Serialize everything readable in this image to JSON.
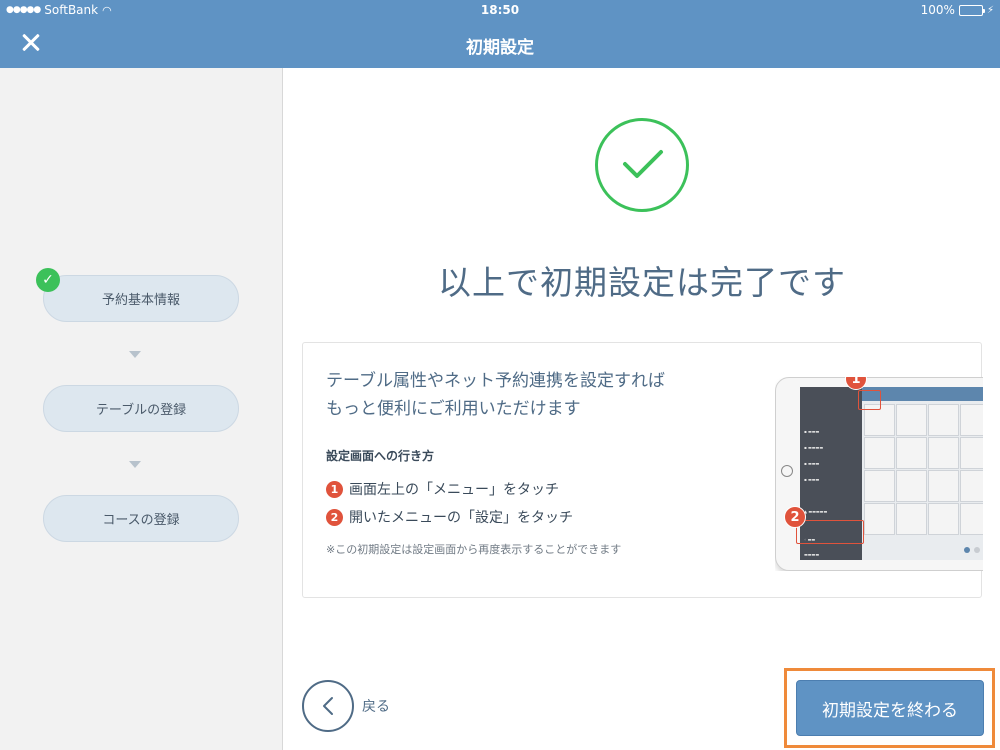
{
  "status_bar": {
    "carrier": "SoftBank",
    "time": "18:50",
    "battery": "100%"
  },
  "header": {
    "title": "初期設定"
  },
  "sidebar": {
    "steps": [
      {
        "label": "予約基本情報",
        "completed": true
      },
      {
        "label": "テーブルの登録",
        "completed": false
      },
      {
        "label": "コースの登録",
        "completed": false
      }
    ]
  },
  "main": {
    "headline": "以上で初期設定は完了です",
    "card": {
      "lead_line1": "テーブル属性やネット予約連携を設定すれば",
      "lead_line2": "もっと便利にご利用いただけます",
      "howto_title": "設定画面への行き方",
      "steps": [
        {
          "num": "1",
          "text": "画面左上の「メニュー」をタッチ"
        },
        {
          "num": "2",
          "text": "開いたメニューの「設定」をタッチ"
        }
      ],
      "note": "※この初期設定は設定画面から再度表示することができます",
      "illustration": {
        "callouts": [
          "1",
          "2"
        ]
      }
    },
    "back_label": "戻る",
    "finish_label": "初期設定を終わる"
  },
  "colors": {
    "header_bg": "#5f93c4",
    "success": "#3cc15a",
    "accent_number": "#e0533c",
    "highlight_border": "#ef8a3a"
  }
}
